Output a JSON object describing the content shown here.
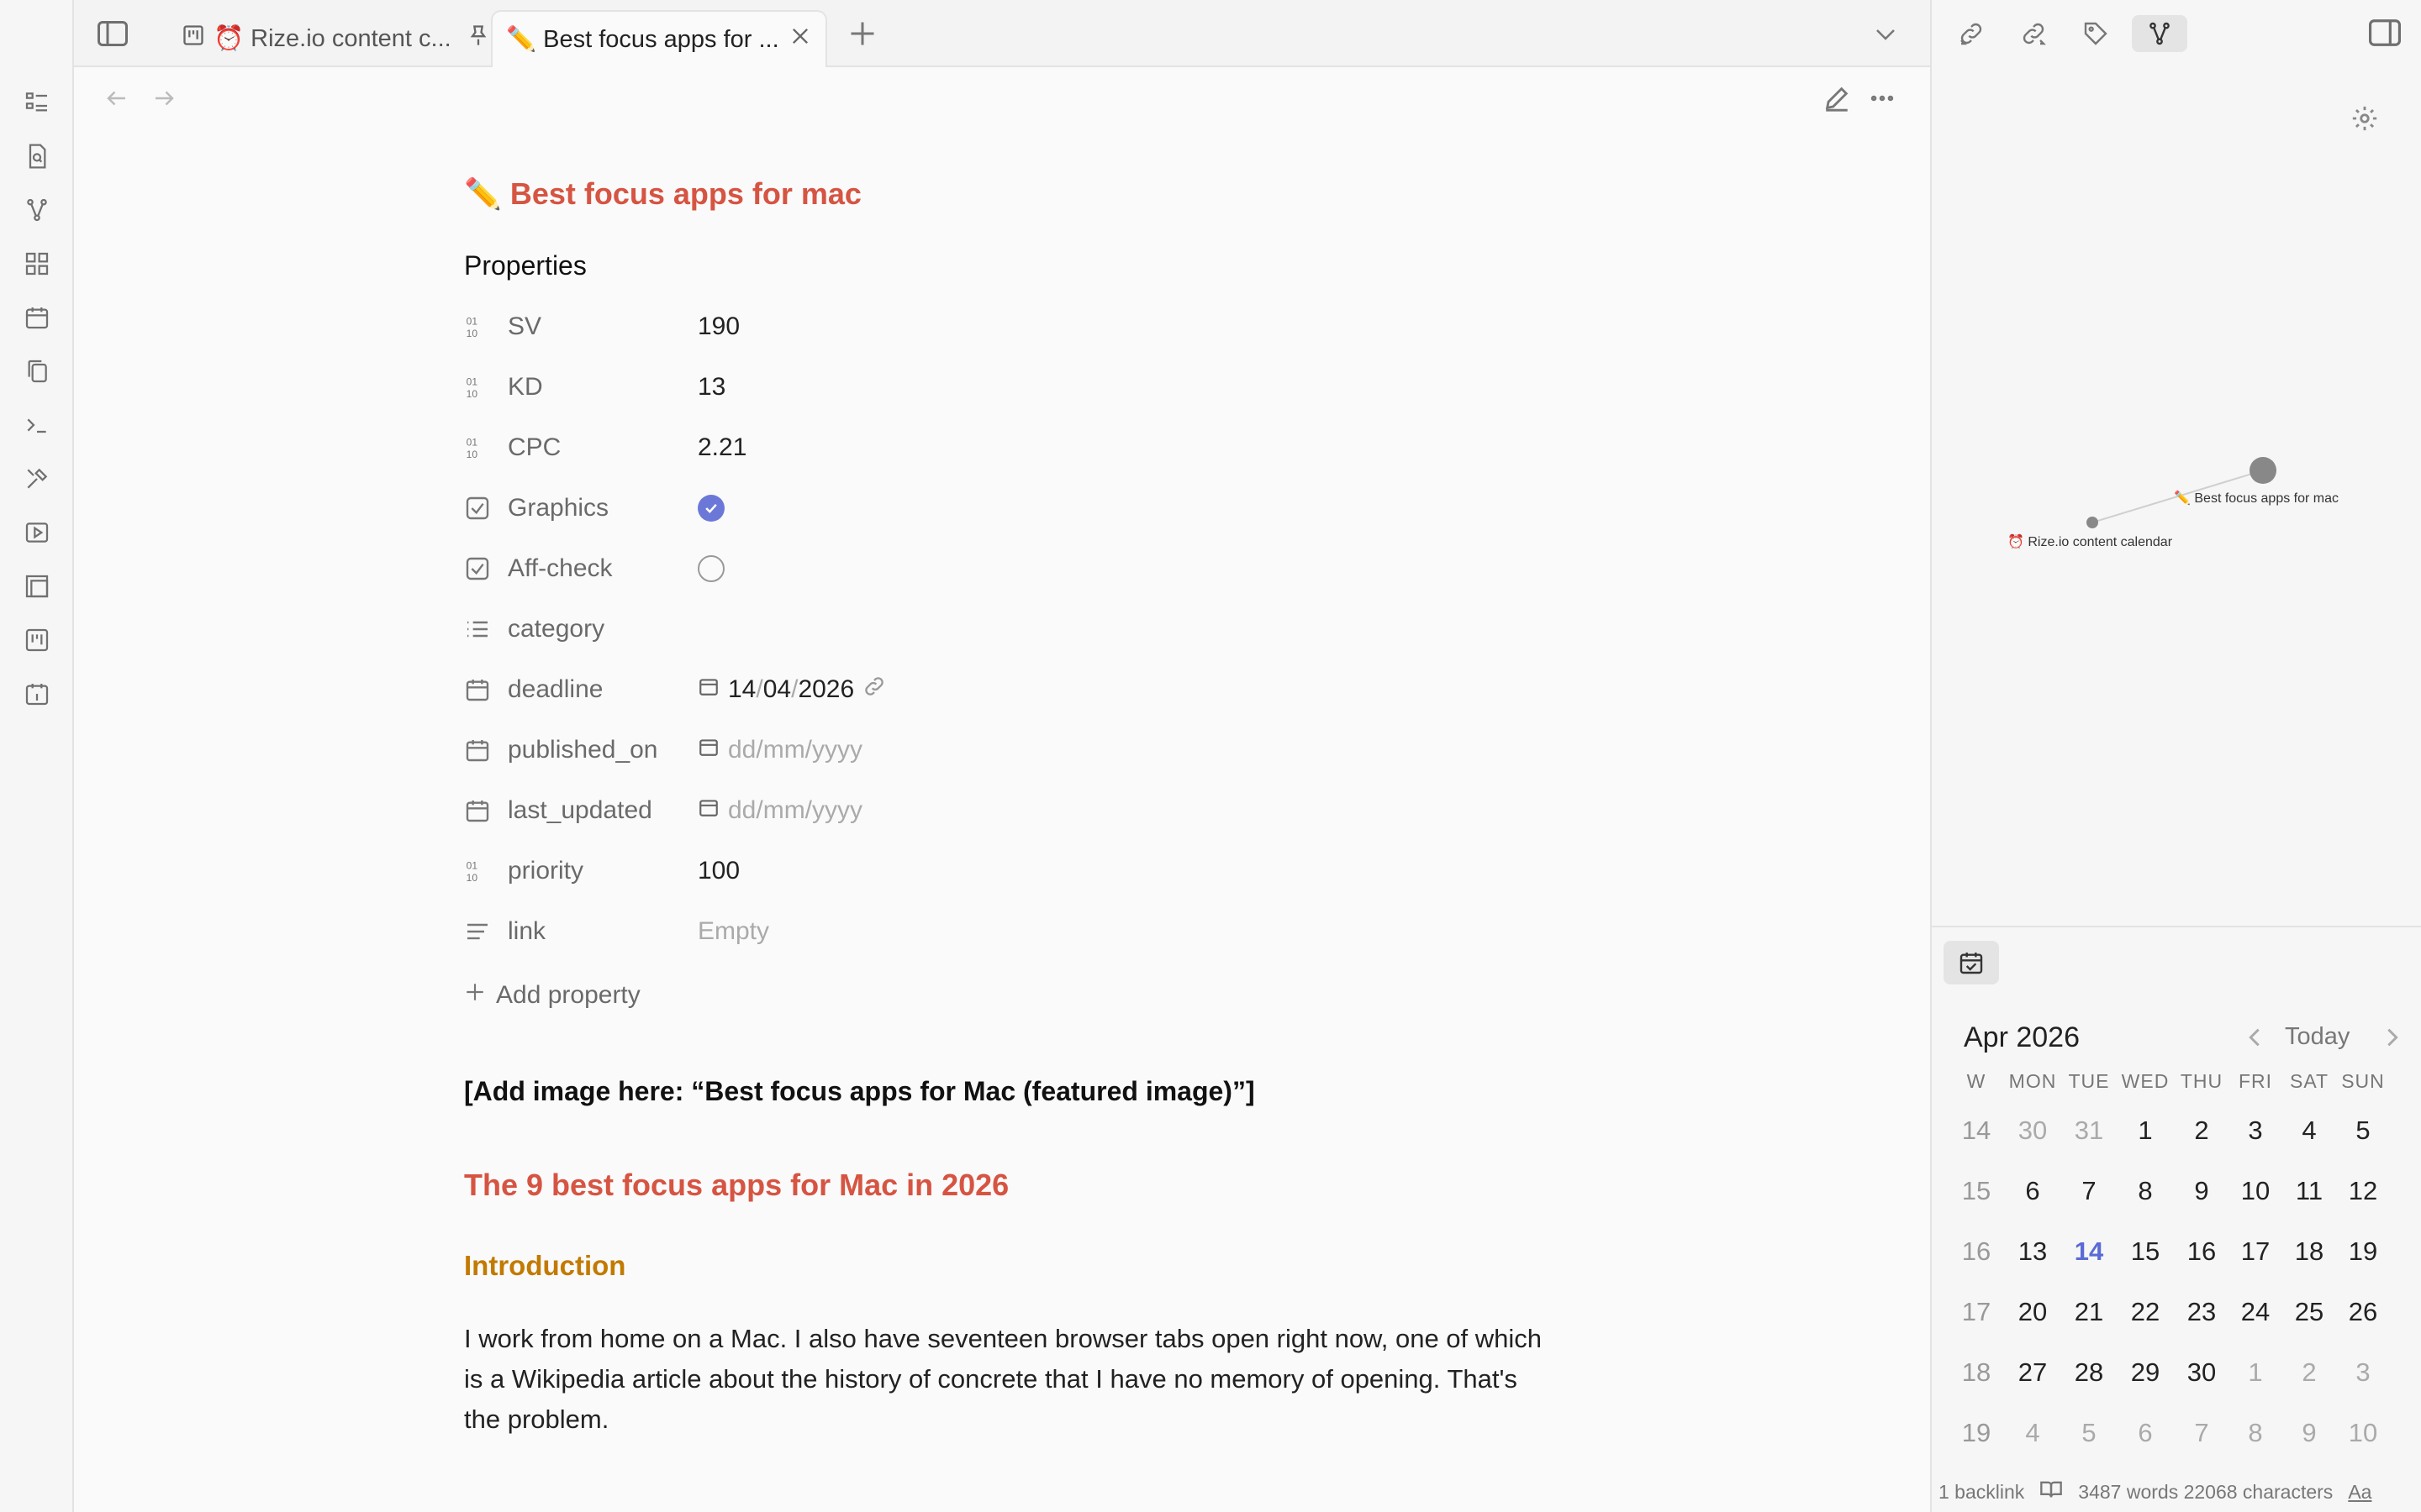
{
  "tabs": [
    {
      "label": "⏰ Rize.io content c..."
    },
    {
      "label": "✏️ Best focus apps for ..."
    }
  ],
  "note": {
    "title": "✏️ Best focus apps for mac",
    "properties_heading": "Properties",
    "properties": [
      {
        "key": "SV",
        "value": "190",
        "type": "number"
      },
      {
        "key": "KD",
        "value": "13",
        "type": "number"
      },
      {
        "key": "CPC",
        "value": "2.21",
        "type": "number"
      },
      {
        "key": "Graphics",
        "value": true,
        "type": "checkbox"
      },
      {
        "key": "Aff-check",
        "value": false,
        "type": "checkbox"
      },
      {
        "key": "category",
        "value": "",
        "type": "list"
      },
      {
        "key": "deadline",
        "value_d": "14",
        "value_m": "04",
        "value_y": "2026",
        "type": "date"
      },
      {
        "key": "published_on",
        "value": "dd/mm/yyyy",
        "type": "date-empty"
      },
      {
        "key": "last_updated",
        "value": "dd/mm/yyyy",
        "type": "date-empty"
      },
      {
        "key": "priority",
        "value": "100",
        "type": "number"
      },
      {
        "key": "link",
        "value": "Empty",
        "type": "text-empty"
      }
    ],
    "add_property": "Add property",
    "image_placeholder": "[Add image here: “Best focus apps for Mac (featured image)”]",
    "h2": "The 9 best focus apps for Mac in 2026",
    "h3": "Introduction",
    "paragraph": "I work from home on a Mac. I also have seventeen browser tabs open right now, one of which is a Wikipedia article about the history of concrete that I have no memory of opening. That's the problem."
  },
  "graph": {
    "nodes": [
      {
        "label": "✏️ Best focus apps for mac"
      },
      {
        "label": "⏰ Rize.io content calendar"
      }
    ]
  },
  "calendar": {
    "month": "Apr 2026",
    "today_label": "Today",
    "headers": [
      "W",
      "MON",
      "TUE",
      "WED",
      "THU",
      "FRI",
      "SAT",
      "SUN"
    ],
    "weeks": [
      {
        "w": "14",
        "days": [
          {
            "d": "30",
            "m": true
          },
          {
            "d": "31",
            "m": true
          },
          {
            "d": "1"
          },
          {
            "d": "2"
          },
          {
            "d": "3"
          },
          {
            "d": "4"
          },
          {
            "d": "5"
          }
        ]
      },
      {
        "w": "15",
        "days": [
          {
            "d": "6"
          },
          {
            "d": "7"
          },
          {
            "d": "8"
          },
          {
            "d": "9"
          },
          {
            "d": "10"
          },
          {
            "d": "11"
          },
          {
            "d": "12"
          }
        ]
      },
      {
        "w": "16",
        "days": [
          {
            "d": "13"
          },
          {
            "d": "14",
            "t": true
          },
          {
            "d": "15"
          },
          {
            "d": "16"
          },
          {
            "d": "17"
          },
          {
            "d": "18"
          },
          {
            "d": "19"
          }
        ]
      },
      {
        "w": "17",
        "days": [
          {
            "d": "20"
          },
          {
            "d": "21"
          },
          {
            "d": "22"
          },
          {
            "d": "23"
          },
          {
            "d": "24"
          },
          {
            "d": "25"
          },
          {
            "d": "26"
          }
        ]
      },
      {
        "w": "18",
        "days": [
          {
            "d": "27"
          },
          {
            "d": "28"
          },
          {
            "d": "29"
          },
          {
            "d": "30"
          },
          {
            "d": "1",
            "m": true
          },
          {
            "d": "2",
            "m": true
          },
          {
            "d": "3",
            "m": true
          }
        ]
      },
      {
        "w": "19",
        "days": [
          {
            "d": "4",
            "m": true
          },
          {
            "d": "5",
            "m": true
          },
          {
            "d": "6",
            "m": true
          },
          {
            "d": "7",
            "m": true
          },
          {
            "d": "8",
            "m": true
          },
          {
            "d": "9",
            "m": true
          },
          {
            "d": "10",
            "m": true
          }
        ]
      }
    ]
  },
  "status": {
    "backlinks": "1 backlink",
    "counts": "3487 words 22068 characters",
    "font_btn": "Aa"
  },
  "colors": {
    "accent": "#6b78d8",
    "heading_red": "#d65442",
    "heading_orange": "#c27a00"
  }
}
